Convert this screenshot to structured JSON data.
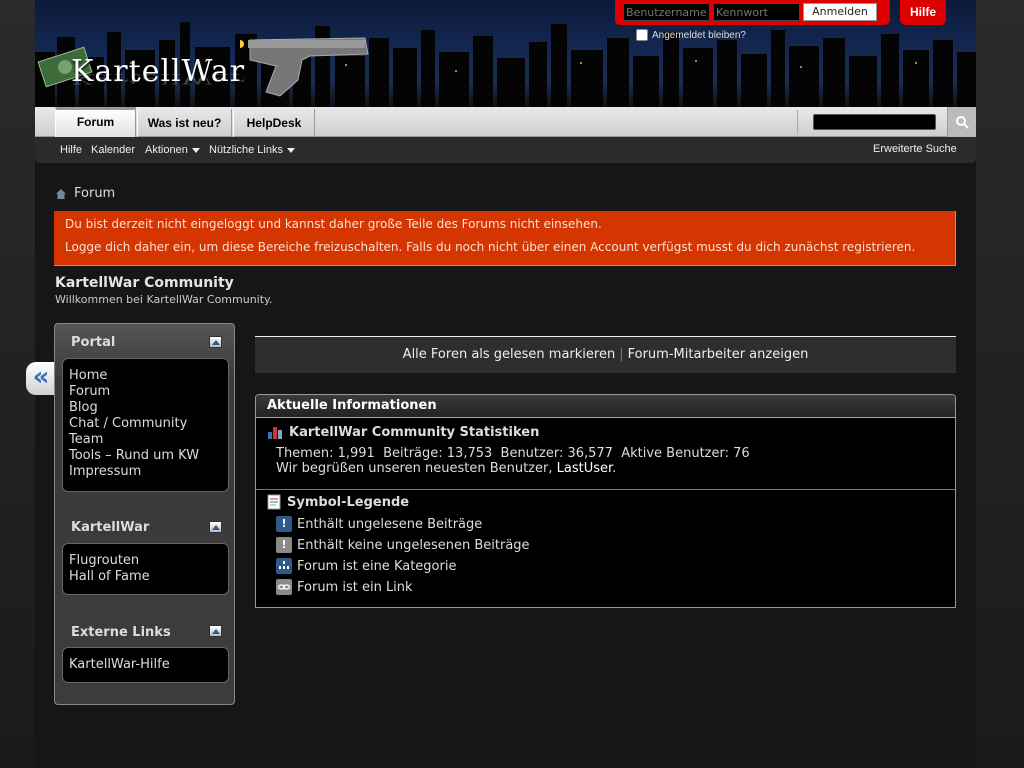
{
  "header": {
    "logo_text": "KartellWar",
    "login": {
      "username_placeholder": "Benutzername",
      "password_placeholder": "Kennwort",
      "submit_label": "Anmelden",
      "remember_label": "Angemeldet bleiben?"
    },
    "help_label": "Hilfe"
  },
  "nav": {
    "tabs": [
      {
        "label": "Forum"
      },
      {
        "label": "Was ist neu?"
      },
      {
        "label": "HelpDesk"
      }
    ],
    "sub": {
      "help": "Hilfe",
      "calendar": "Kalender",
      "actions": "Aktionen",
      "useful_links": "Nützliche Links",
      "advanced_search": "Erweiterte Suche"
    }
  },
  "breadcrumb": {
    "label": "Forum"
  },
  "notice": {
    "line1": "Du bist derzeit nicht eingeloggt und kannst daher große Teile des Forums nicht einsehen.",
    "line2": "Logge dich daher ein, um diese Bereiche freizuschalten. Falls du noch nicht über einen Account verfügst musst du dich zunächst registrieren."
  },
  "community": {
    "title": "KartellWar Community",
    "subtitle": "Willkommen bei KartellWar Community."
  },
  "sidebar": {
    "collapse_glyph": "«",
    "blocks": [
      {
        "title": "Portal",
        "items": [
          "Home",
          "Forum",
          "Blog",
          "Chat / Community",
          "Team",
          "Tools – Rund um KW",
          "Impressum"
        ]
      },
      {
        "title": "KartellWar",
        "items": [
          "Flugrouten",
          "Hall of Fame"
        ]
      },
      {
        "title": "Externe Links",
        "items": [
          "KartellWar-Hilfe"
        ]
      }
    ]
  },
  "main": {
    "mark_read": "Alle Foren als gelesen markieren",
    "separator": "|",
    "show_staff": "Forum-Mitarbeiter anzeigen",
    "info": {
      "title": "Aktuelle Informationen",
      "stats_title": "KartellWar Community Statistiken",
      "stats_line": "Themen: 1,991  Beiträge: 13,753  Benutzer: 36,577  Aktive Benutzer: 76",
      "welcome_prefix": "Wir begrüßen unseren neuesten Benutzer, ",
      "newest_user": "LastUser",
      "welcome_suffix": ".",
      "legend_title": "Symbol-Legende",
      "legend": [
        {
          "label": "Enthält ungelesene Beiträge",
          "icon": "new-posts-icon",
          "color": "#2d5a8a"
        },
        {
          "label": "Enthält keine ungelesenen Beiträge",
          "icon": "old-posts-icon",
          "color": "#8a8a8a"
        },
        {
          "label": "Forum ist eine Kategorie",
          "icon": "category-icon",
          "color": "#2d5a8a"
        },
        {
          "label": "Forum ist ein Link",
          "icon": "link-icon",
          "color": "#8a8a8a"
        }
      ]
    }
  },
  "colors": {
    "accent_red": "#dd0000",
    "notice_bg": "#d53500",
    "link_blue": "#3a6fb0"
  }
}
